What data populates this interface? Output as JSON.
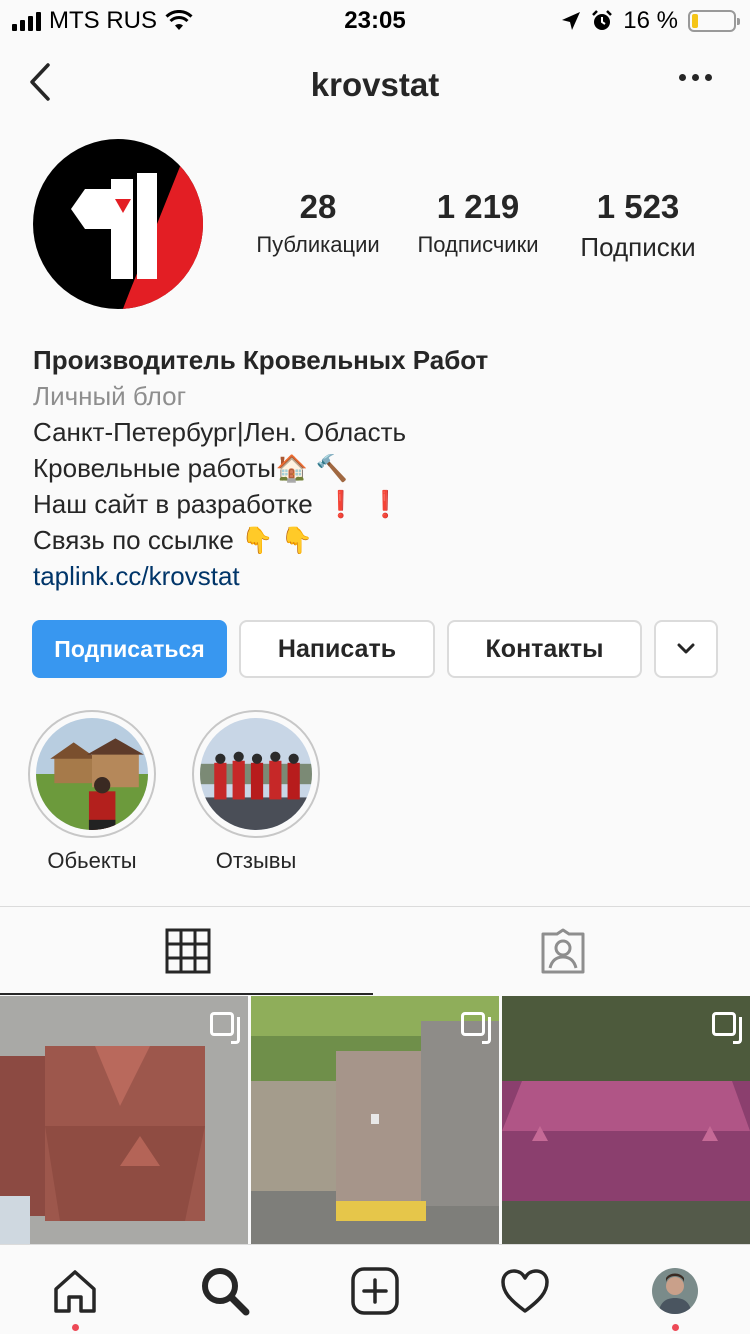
{
  "status_bar": {
    "carrier": "MTS RUS",
    "time": "23:05",
    "battery": "16 %",
    "battery_level": 0.16
  },
  "nav": {
    "username": "krovstat",
    "back_icon": "chevron-left-icon",
    "more_icon": "more-horizontal-icon"
  },
  "profile": {
    "stats": [
      {
        "value": "28",
        "label": "Публикации"
      },
      {
        "value": "1 219",
        "label": "Подписчики"
      },
      {
        "value": "1 523",
        "label": "Подписки"
      }
    ]
  },
  "bio": {
    "name": "Производитель Кровельных Работ",
    "category": "Личный блог",
    "lines": [
      "Санкт-Петербург|Лен. Область",
      "Кровельные работы🏠 🔨",
      "Наш сайт в разработке",
      "Связь по ссылке 👇 👇"
    ],
    "line3_marks": "❗",
    "link": "taplink.cc/krovstat"
  },
  "buttons": {
    "follow": "Подписаться",
    "message": "Написать",
    "contacts": "Контакты"
  },
  "highlights": [
    {
      "label": "Обьекты"
    },
    {
      "label": "Отзывы"
    }
  ],
  "colors": {
    "primary": "#3897f0",
    "link": "#003569",
    "brand_red": "#e31e24"
  }
}
